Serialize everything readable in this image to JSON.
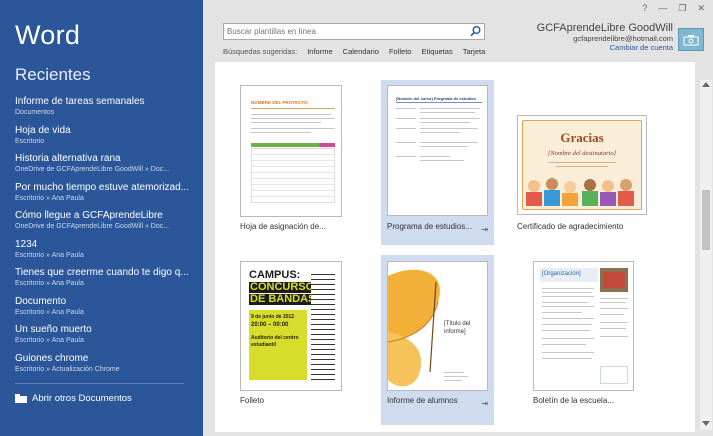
{
  "app": {
    "title": "Word",
    "recent_heading": "Recientes"
  },
  "recent": [
    {
      "name": "Informe de tareas semanales",
      "path": "Documentos"
    },
    {
      "name": "Hoja de vida",
      "path": "Escritorio"
    },
    {
      "name": "Historia alternativa rana",
      "path": "OneDrive de GCFAprendeLibre GoodWill » Doc..."
    },
    {
      "name": "Por mucho tiempo estuve atemorizad...",
      "path": "Escritorio » Ana Paula"
    },
    {
      "name": "Cómo llegue a GCFAprendeLibre",
      "path": "OneDrive de GCFAprendeLibre GoodWill » Doc..."
    },
    {
      "name": "1234",
      "path": "Escritorio » Ana Paula"
    },
    {
      "name": "Tienes que creerme cuando te digo q...",
      "path": "Escritorio » Ana Paula"
    },
    {
      "name": "Documento",
      "path": "Escritorio » Ana Paula"
    },
    {
      "name": "Un sueño muerto",
      "path": "Escritorio » Ana Paula"
    },
    {
      "name": "Guiones chrome",
      "path": "Escritorio » Actualización Chrome"
    }
  ],
  "open_other_label": "Abrir otros Documentos",
  "search": {
    "placeholder": "Buscar plantillas en línea"
  },
  "suggested": {
    "label": "Búsquedas sugeridas:",
    "items": [
      "Informe",
      "Calendario",
      "Folleto",
      "Etiquetas",
      "Tarjeta"
    ]
  },
  "account": {
    "name": "GCFAprendeLibre GoodWill",
    "email": "gcfaprendelibre@hotmail.com",
    "switch_label": "Cambiar de cuenta"
  },
  "window_controls": {
    "help": "?",
    "minimize": "—",
    "restore": "❐",
    "close": "✕"
  },
  "templates": [
    {
      "label": "Hoja de asignación de...",
      "selected": false,
      "pinned": false
    },
    {
      "label": "Programa de estudios...",
      "selected": true,
      "pinned": true
    },
    {
      "label": "Certificado de agradecimiento",
      "selected": false,
      "pinned": false
    },
    {
      "label": "Folleto",
      "selected": false,
      "pinned": false
    },
    {
      "label": "Informe de alumnos",
      "selected": true,
      "pinned": true
    },
    {
      "label": "Boletín de la escuela...",
      "selected": false,
      "pinned": false
    }
  ],
  "thumbs": {
    "assignment_title": "NOMBRE DEL PROYECTO",
    "syllabus_title": "[Nombre del curso] Programa de estudios",
    "cert_title": "Gracias",
    "cert_recipient": "[Nombre del destinatario]",
    "flyer_line1": "CAMPUS:",
    "flyer_line2": "CONCURSO",
    "flyer_line3": "DE BANDAS",
    "flyer_date": "9 de junio de 2012",
    "flyer_time": "20:00 – 00:00",
    "flyer_place1": "Auditorio del centro",
    "flyer_place2": "estudiantil",
    "report_title1": "[Título del",
    "report_title2": "informe]",
    "newsletter_title": "[Organización]"
  },
  "colors": {
    "sidebar": "#2b579a",
    "selected_tile": "#cfdbee",
    "flyer_yellow": "#d8dc2b",
    "butterfly": "#f4b13a"
  }
}
